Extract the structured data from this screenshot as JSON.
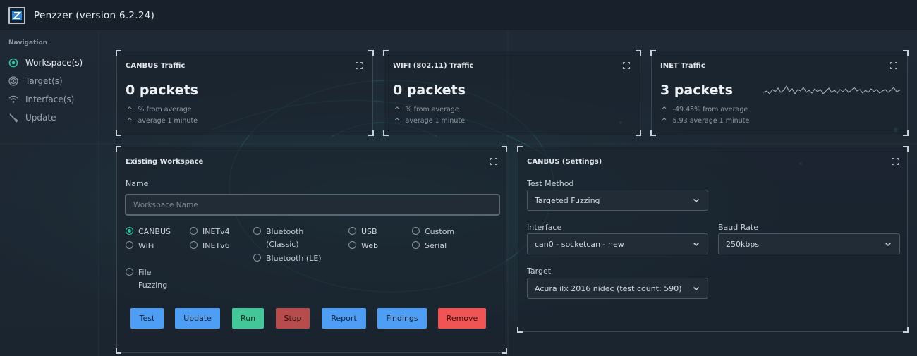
{
  "app": {
    "title": "Penzzer (version 6.2.24)",
    "logo_icon": "penzzer-logo"
  },
  "sidebar": {
    "heading": "Navigation",
    "items": [
      {
        "label": "Workspace(s)",
        "icon": "workspace-icon",
        "active": true
      },
      {
        "label": "Target(s)",
        "icon": "target-icon",
        "active": false
      },
      {
        "label": "Interface(s)",
        "icon": "wifi-icon",
        "active": false
      },
      {
        "label": "Update",
        "icon": "wrench-icon",
        "active": false
      }
    ]
  },
  "traffic": [
    {
      "title": "CANBUS Traffic",
      "value": "0 packets",
      "line1": "% from average",
      "line2": "average 1 minute"
    },
    {
      "title": "WIFI (802.11) Traffic",
      "value": "0 packets",
      "line1": "% from average",
      "line2": "average 1 minute"
    },
    {
      "title": "INET Traffic",
      "value": "3 packets",
      "line1": "-49.45% from average",
      "line2": "5.93 average 1 minute"
    }
  ],
  "workspace": {
    "title": "Existing Workspace",
    "name_label": "Name",
    "name_placeholder": "Workspace Name",
    "name_value": "",
    "types": [
      {
        "label": "CANBUS",
        "checked": true
      },
      {
        "label": "WiFi",
        "checked": false
      },
      {
        "label": "File Fuzzing",
        "checked": false
      },
      {
        "label": "INETv4",
        "checked": false
      },
      {
        "label": "INETv6",
        "checked": false
      },
      {
        "label": "Bluetooth (Classic)",
        "checked": false
      },
      {
        "label": "Bluetooth (LE)",
        "checked": false
      },
      {
        "label": "USB",
        "checked": false
      },
      {
        "label": "Web",
        "checked": false
      },
      {
        "label": "Custom",
        "checked": false
      },
      {
        "label": "Serial",
        "checked": false
      }
    ],
    "buttons": [
      "Test",
      "Update",
      "Run",
      "Stop",
      "Report",
      "Findings",
      "Remove"
    ]
  },
  "settings": {
    "title": "CANBUS (Settings)",
    "test_method_label": "Test Method",
    "test_method_value": "Targeted Fuzzing",
    "interface_label": "Interface",
    "interface_value": "can0 - socketcan - new",
    "baud_label": "Baud Rate",
    "baud_value": "250kbps",
    "target_label": "Target",
    "target_value": "Acura ilx 2016 nidec (test count: 590)"
  },
  "colors": {
    "accent": "#2fc59f",
    "blue": "#4f9ef6",
    "green": "#43c799",
    "stop": "#b74c4c",
    "remove": "#f05454"
  }
}
